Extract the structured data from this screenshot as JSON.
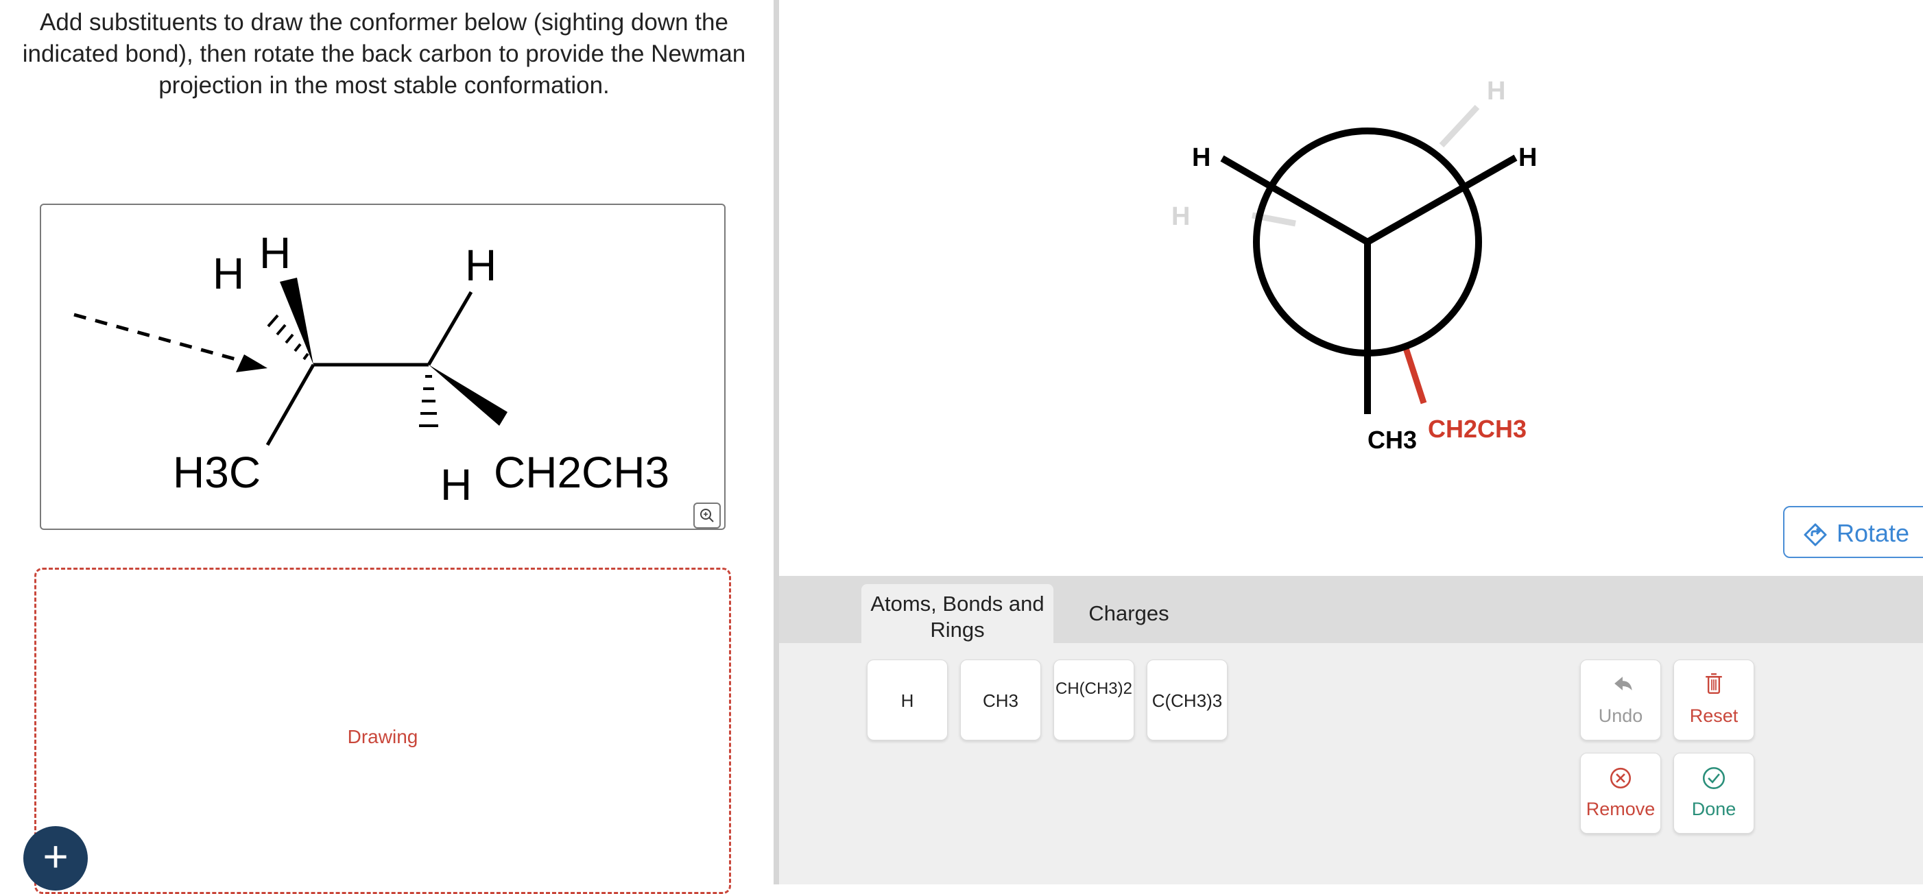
{
  "question": {
    "text": "Add substituents to draw the conformer below (sighting down the indicated bond), then rotate the back carbon to provide the Newman projection in the most stable conformation."
  },
  "molecule": {
    "labels": {
      "h_top_left": "H",
      "h_top": "H",
      "h_top_right": "H",
      "h_bottom_right": "H",
      "ch3_left": "H3C",
      "ch2ch3_right": "CH2CH3"
    }
  },
  "drawing": {
    "label": "Drawing"
  },
  "newman": {
    "front": {
      "upper_left": "H",
      "upper_right": "H",
      "down": "CH3"
    },
    "back": {
      "top": "H",
      "left": "H",
      "bottom": "CH2CH3"
    },
    "colors": {
      "bond": "#000000",
      "ghost": "#d9d9d9",
      "selected": "#cf3b2b"
    }
  },
  "rotate_button": {
    "label": "Rotate"
  },
  "tabs": [
    {
      "label": "Atoms, Bonds and Rings",
      "active": true
    },
    {
      "label": "Charges",
      "active": false
    }
  ],
  "fragments": [
    "H",
    "CH3",
    "CH(CH3)2",
    "C(CH3)3"
  ],
  "actions": {
    "undo": "Undo",
    "reset": "Reset",
    "remove": "Remove",
    "done": "Done"
  },
  "colors": {
    "accent_red": "#c9473b",
    "accent_blue": "#3a86d4",
    "accent_green": "#2a8f7a",
    "dark_navy": "#1d3d5e"
  }
}
